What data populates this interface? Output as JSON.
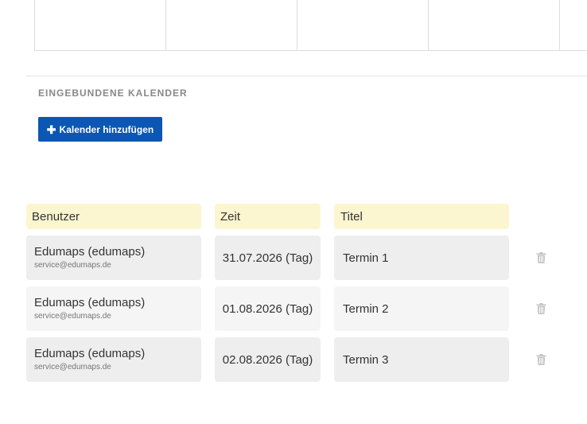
{
  "section": {
    "title": "EINGEBUNDENE KALENDER",
    "add_button_label": "Kalender hinzufügen"
  },
  "table": {
    "headers": {
      "user": "Benutzer",
      "time": "Zeit",
      "title": "Titel"
    },
    "rows": [
      {
        "user_name": "Edumaps (edumaps)",
        "user_email": "service@edumaps.de",
        "time": "31.07.2026 (Tag)",
        "title": "Termin 1"
      },
      {
        "user_name": "Edumaps (edumaps)",
        "user_email": "service@edumaps.de",
        "time": "01.08.2026 (Tag)",
        "title": "Termin 2"
      },
      {
        "user_name": "Edumaps (edumaps)",
        "user_email": "service@edumaps.de",
        "time": "02.08.2026 (Tag)",
        "title": "Termin 3"
      }
    ]
  },
  "icons": {
    "add": "plus-icon",
    "delete": "trash-icon"
  },
  "colors": {
    "button": "#0b57b3",
    "header_bg": "#fbf6cf",
    "row_bg_dark": "#eeeeee",
    "row_bg_light": "#f5f5f5"
  }
}
